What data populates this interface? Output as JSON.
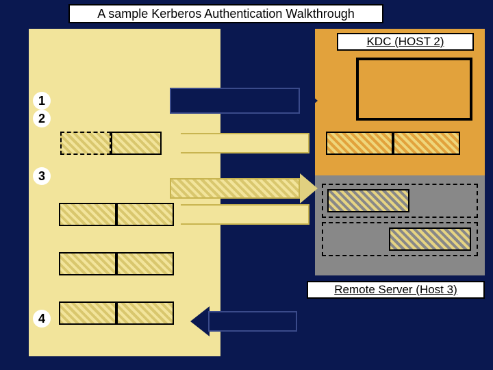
{
  "title": "A sample Kerberos Authentication Walkthrough",
  "kdc_label": "KDC (HOST 2)",
  "remote_label": "Remote Server (Host 3)",
  "steps": {
    "s1": "1",
    "s2": "2",
    "s3": "3",
    "s4": "4"
  },
  "footer_link": "",
  "colors": {
    "navy": "#0a1850",
    "khaki": "#f2e49b",
    "orange": "#e2a23c",
    "gray": "#888888"
  },
  "chart_data": {
    "type": "diagram",
    "title": "A sample Kerberos Authentication Walkthrough",
    "participants": [
      {
        "id": "client",
        "label": "",
        "note": "left khaki panel (client / HOST 1)"
      },
      {
        "id": "kdc",
        "label": "KDC (HOST 2)"
      },
      {
        "id": "remote",
        "label": "Remote Server (Host 3)"
      }
    ],
    "messages": [
      {
        "step": 1,
        "from": "client",
        "to": "kdc",
        "direction": "right",
        "style": "solid-navy"
      },
      {
        "step": 2,
        "from": "kdc",
        "to": "client",
        "direction": "left",
        "style": "khaki-outline",
        "payload_boxes": 2
      },
      {
        "step": 3,
        "from": "client",
        "to": "kdc",
        "direction": "right",
        "style": "khaki-hatched",
        "payload_boxes": 2
      },
      {
        "step": 3.5,
        "from": "kdc",
        "to": "client",
        "direction": "left",
        "style": "khaki-outline",
        "payload_boxes": 2
      },
      {
        "step": 4,
        "from": "client",
        "to": "remote",
        "direction": "both",
        "style": "solid-navy"
      }
    ]
  }
}
